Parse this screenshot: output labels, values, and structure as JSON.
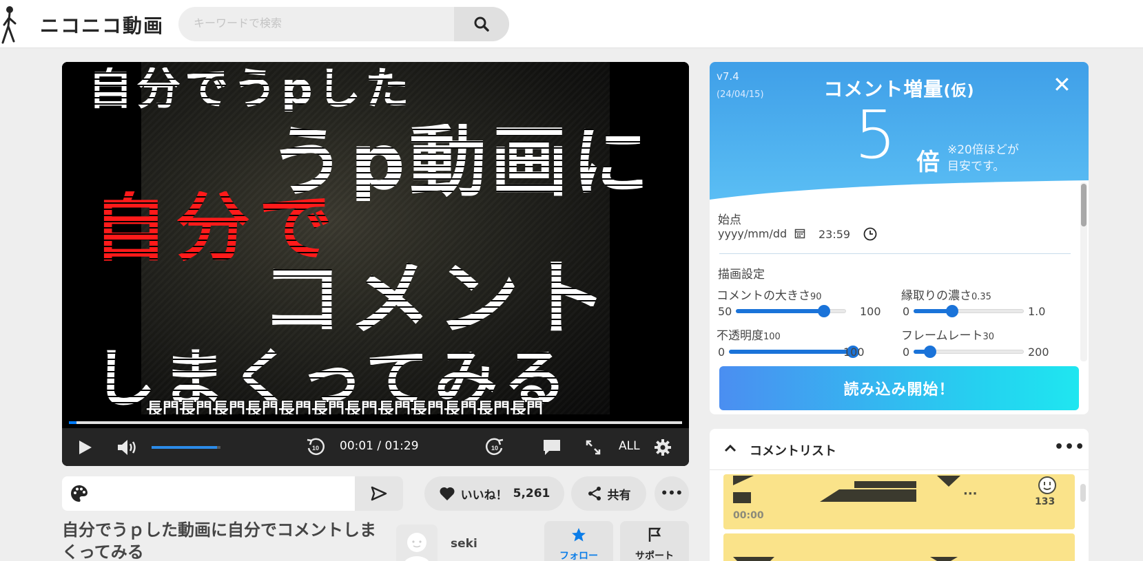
{
  "header": {
    "logo_text": "ニコニコ動画",
    "search_placeholder": "キーワードで検索",
    "search_icon": "search-icon"
  },
  "player": {
    "video_text": {
      "line1": "自分でうpした",
      "line2": "うp動画に",
      "line3": "自分で",
      "line4": "コメント",
      "line5": "しまくってみる"
    },
    "scrolling_comment": "長門長門長門長門長門長門長門長門長門長門長門長門",
    "time_display": "00:01 / 01:29",
    "progress_fraction": 0.012,
    "volume_fraction": 0.95,
    "comment_filter": "ALL",
    "icons": [
      "play-icon",
      "volume-icon",
      "rewind-10-icon",
      "forward-10-icon",
      "comment-toggle-icon",
      "fullscreen-icon",
      "settings-icon"
    ]
  },
  "comment_bar": {
    "value": "",
    "palette_icon": "palette-icon",
    "send_icon": "send-icon"
  },
  "actions": {
    "like_label": "いいね！",
    "like_count": "5,261",
    "share_label": "共有",
    "more_label": "•••"
  },
  "video": {
    "title": "自分でうｐした動画に自分でコメントしまくってみる"
  },
  "uploader": {
    "name": "seki",
    "follow_label": "フォロー",
    "support_label": "サポート"
  },
  "extension_panel": {
    "version": "v7.4",
    "date": "(24/04/15)",
    "title": "コメント増量",
    "title_suffix": "(仮)",
    "close_label": "✕",
    "multiplier": "5",
    "multiplier_unit": "倍",
    "note": "※20倍ほどが目安です。",
    "start_label": "始点",
    "date_placeholder": "yyyy/mm/dd",
    "time_value": "23:59",
    "render_label": "描画設定",
    "sliders": [
      {
        "label": "コメントの大きさ",
        "value": "90",
        "min": "50",
        "max": "100",
        "fraction": 0.8
      },
      {
        "label": "縁取りの濃さ",
        "value": "0.35",
        "min": "0",
        "max": "1.0",
        "fraction": 0.35
      },
      {
        "label": "不透明度",
        "value": "100",
        "min": "0",
        "max": "100",
        "fraction": 1.0
      },
      {
        "label": "フレームレート",
        "value": "30",
        "min": "0",
        "max": "200",
        "fraction": 0.15
      }
    ],
    "load_button": "読み込み開始！",
    "accent_color": "#1a73d9"
  },
  "comment_list": {
    "title": "コメントリスト",
    "more_label": "•••",
    "items": [
      {
        "time": "00:00",
        "count": "133",
        "more": "···"
      }
    ]
  }
}
